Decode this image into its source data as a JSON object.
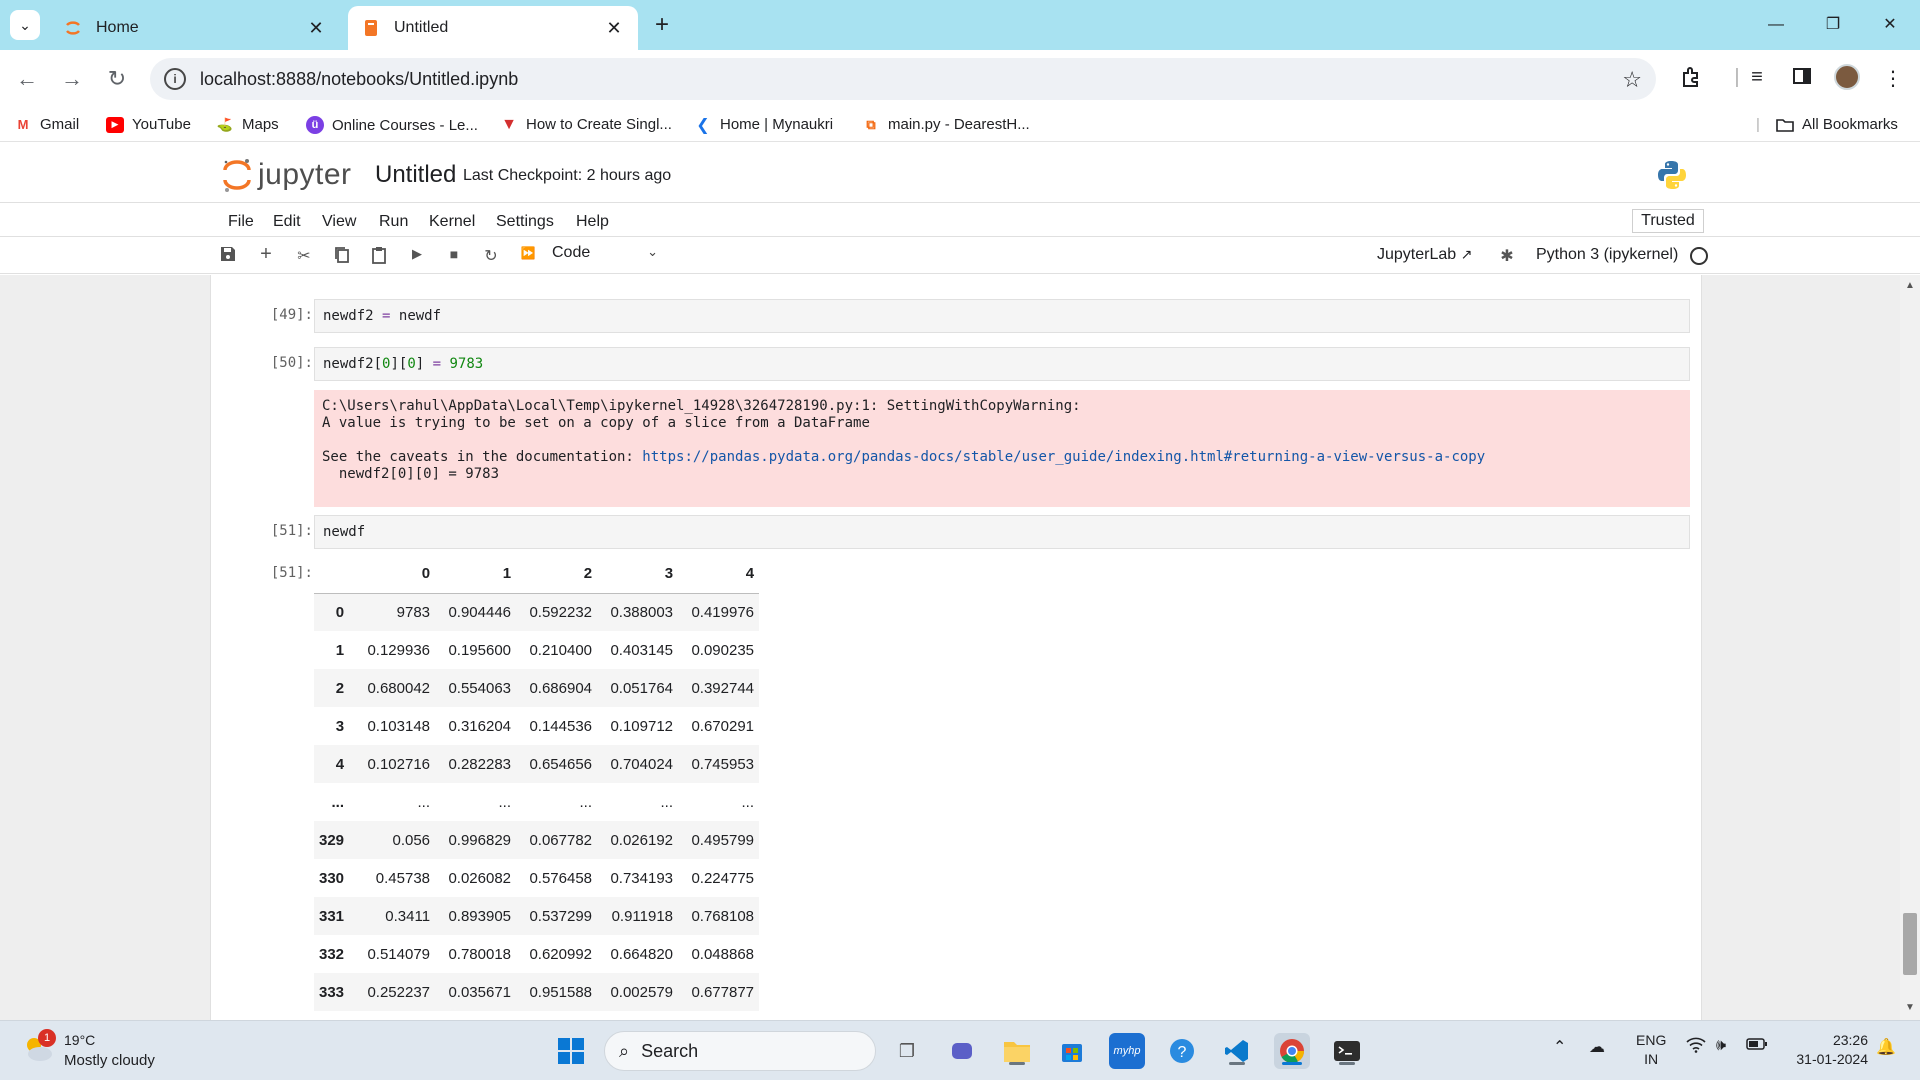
{
  "browser": {
    "tabs": [
      {
        "title": "Home",
        "close": "✕"
      },
      {
        "title": "Untitled",
        "close": "✕"
      }
    ],
    "new_tab": "+",
    "url": "localhost:8888/notebooks/Untitled.ipynb",
    "bookmarks": [
      {
        "label": "Gmail",
        "icon": "gmail-icon"
      },
      {
        "label": "YouTube",
        "icon": "youtube-icon"
      },
      {
        "label": "Maps",
        "icon": "maps-icon"
      },
      {
        "label": "Online Courses - Le...",
        "icon": "courses-icon"
      },
      {
        "label": "How to Create Singl...",
        "icon": "vercel-icon"
      },
      {
        "label": "Home | Mynaukri",
        "icon": "mynaukri-icon"
      },
      {
        "label": "main.py - DearestH...",
        "icon": "replit-icon"
      }
    ],
    "all_bookmarks": "All Bookmarks"
  },
  "jupyter": {
    "logo_text": "jupyter",
    "notebook_title": "Untitled",
    "checkpoint": "Last Checkpoint: 2 hours ago",
    "menu": [
      "File",
      "Edit",
      "View",
      "Run",
      "Kernel",
      "Settings",
      "Help"
    ],
    "trusted": "Trusted",
    "cell_type": "Code",
    "jupyterlab_link": "JupyterLab",
    "kernel": "Python 3 (ipykernel)"
  },
  "cells": [
    {
      "prompt": "[49]:",
      "code_var": "newdf2",
      "code_op": "=",
      "code_rhs": "newdf"
    },
    {
      "prompt": "[50]:",
      "code_lhs": "newdf2[",
      "idx1": "0",
      "mid": "][",
      "idx2": "0",
      "close": "]",
      "op": "=",
      "value": "9783"
    },
    {
      "prompt": "[51]:",
      "code": "newdf"
    }
  ],
  "stderr": {
    "line1": "C:\\Users\\rahul\\AppData\\Local\\Temp\\ipykernel_14928\\3264728190.py:1: SettingWithCopyWarning:",
    "line2": "A value is trying to be set on a copy of a slice from a DataFrame",
    "line3_prefix": "See the caveats in the documentation: ",
    "link": "https://pandas.pydata.org/pandas-docs/stable/user_guide/indexing.html#returning-a-view-versus-a-copy",
    "line4": "  newdf2[0][0] = 9783"
  },
  "output_prompt": "[51]:",
  "dataframe": {
    "columns": [
      "0",
      "1",
      "2",
      "3",
      "4"
    ],
    "rows": [
      {
        "index": "0",
        "values": [
          "9783",
          "0.904446",
          "0.592232",
          "0.388003",
          "0.419976"
        ]
      },
      {
        "index": "1",
        "values": [
          "0.129936",
          "0.195600",
          "0.210400",
          "0.403145",
          "0.090235"
        ]
      },
      {
        "index": "2",
        "values": [
          "0.680042",
          "0.554063",
          "0.686904",
          "0.051764",
          "0.392744"
        ]
      },
      {
        "index": "3",
        "values": [
          "0.103148",
          "0.316204",
          "0.144536",
          "0.109712",
          "0.670291"
        ]
      },
      {
        "index": "4",
        "values": [
          "0.102716",
          "0.282283",
          "0.654656",
          "0.704024",
          "0.745953"
        ]
      },
      {
        "index": "...",
        "values": [
          "...",
          "...",
          "...",
          "...",
          "..."
        ]
      },
      {
        "index": "329",
        "values": [
          "0.056",
          "0.996829",
          "0.067782",
          "0.026192",
          "0.495799"
        ]
      },
      {
        "index": "330",
        "values": [
          "0.45738",
          "0.026082",
          "0.576458",
          "0.734193",
          "0.224775"
        ]
      },
      {
        "index": "331",
        "values": [
          "0.3411",
          "0.893905",
          "0.537299",
          "0.911918",
          "0.768108"
        ]
      },
      {
        "index": "332",
        "values": [
          "0.514079",
          "0.780018",
          "0.620992",
          "0.664820",
          "0.048868"
        ]
      },
      {
        "index": "333",
        "values": [
          "0.252237",
          "0.035671",
          "0.951588",
          "0.002579",
          "0.677877"
        ]
      }
    ]
  },
  "taskbar": {
    "weather_badge": "1",
    "temp": "19°C",
    "condition": "Mostly cloudy",
    "search": "Search",
    "lang_line1": "ENG",
    "lang_line2": "IN",
    "time": "23:26",
    "date": "31-01-2024"
  }
}
